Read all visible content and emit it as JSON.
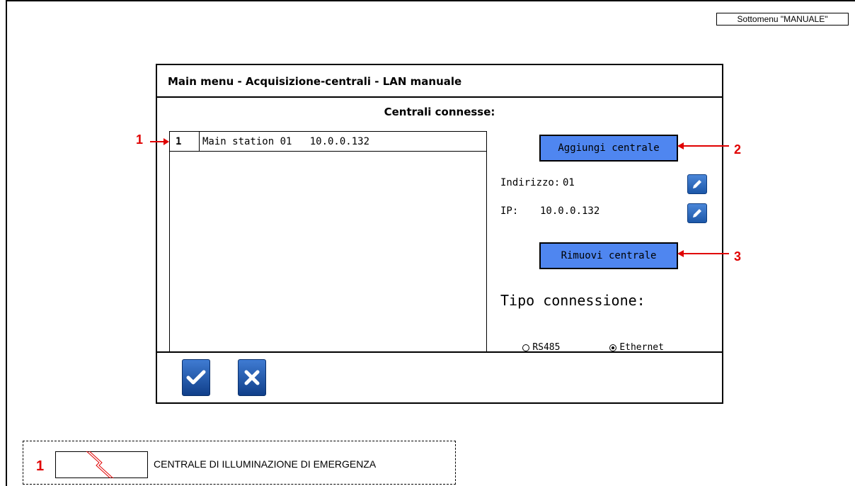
{
  "submenu_tag": "Sottomenu \"MANUALE\"",
  "window": {
    "title": "Main menu - Acquisizione-centrali - LAN manuale",
    "subtitle": "Centrali connesse:"
  },
  "station_list": {
    "rows": [
      {
        "num": "1",
        "text": "Main station 01   10.0.0.132"
      }
    ]
  },
  "buttons": {
    "add": "Aggiungi centrale",
    "remove": "Rimuovi centrale"
  },
  "fields": {
    "address_label": "Indirizzo:",
    "address_value": "01",
    "ip_label": "IP:",
    "ip_value": "10.0.0.132"
  },
  "connection": {
    "title": "Tipo connessione:",
    "options": [
      "RS485",
      "Ethernet"
    ],
    "selected": "Ethernet"
  },
  "callouts": [
    "1",
    "2",
    "3"
  ],
  "legend": {
    "num": "1",
    "text": "CENTRALE DI ILLUMINAZIONE DI EMERGENZA"
  },
  "colors": {
    "button_blue": "#4f86f0",
    "callout_red": "#e00000"
  }
}
